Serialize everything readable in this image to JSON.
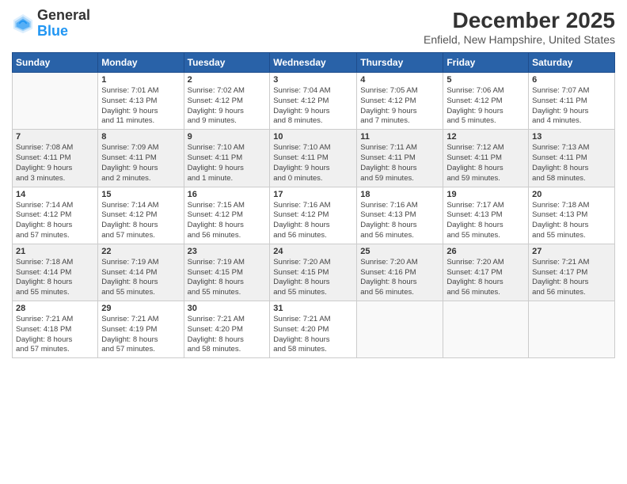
{
  "logo": {
    "line1": "General",
    "line2": "Blue"
  },
  "title": "December 2025",
  "location": "Enfield, New Hampshire, United States",
  "weekdays": [
    "Sunday",
    "Monday",
    "Tuesday",
    "Wednesday",
    "Thursday",
    "Friday",
    "Saturday"
  ],
  "weeks": [
    [
      {
        "day": "",
        "info": ""
      },
      {
        "day": "1",
        "info": "Sunrise: 7:01 AM\nSunset: 4:13 PM\nDaylight: 9 hours\nand 11 minutes."
      },
      {
        "day": "2",
        "info": "Sunrise: 7:02 AM\nSunset: 4:12 PM\nDaylight: 9 hours\nand 9 minutes."
      },
      {
        "day": "3",
        "info": "Sunrise: 7:04 AM\nSunset: 4:12 PM\nDaylight: 9 hours\nand 8 minutes."
      },
      {
        "day": "4",
        "info": "Sunrise: 7:05 AM\nSunset: 4:12 PM\nDaylight: 9 hours\nand 7 minutes."
      },
      {
        "day": "5",
        "info": "Sunrise: 7:06 AM\nSunset: 4:12 PM\nDaylight: 9 hours\nand 5 minutes."
      },
      {
        "day": "6",
        "info": "Sunrise: 7:07 AM\nSunset: 4:11 PM\nDaylight: 9 hours\nand 4 minutes."
      }
    ],
    [
      {
        "day": "7",
        "info": "Sunrise: 7:08 AM\nSunset: 4:11 PM\nDaylight: 9 hours\nand 3 minutes."
      },
      {
        "day": "8",
        "info": "Sunrise: 7:09 AM\nSunset: 4:11 PM\nDaylight: 9 hours\nand 2 minutes."
      },
      {
        "day": "9",
        "info": "Sunrise: 7:10 AM\nSunset: 4:11 PM\nDaylight: 9 hours\nand 1 minute."
      },
      {
        "day": "10",
        "info": "Sunrise: 7:10 AM\nSunset: 4:11 PM\nDaylight: 9 hours\nand 0 minutes."
      },
      {
        "day": "11",
        "info": "Sunrise: 7:11 AM\nSunset: 4:11 PM\nDaylight: 8 hours\nand 59 minutes."
      },
      {
        "day": "12",
        "info": "Sunrise: 7:12 AM\nSunset: 4:11 PM\nDaylight: 8 hours\nand 59 minutes."
      },
      {
        "day": "13",
        "info": "Sunrise: 7:13 AM\nSunset: 4:11 PM\nDaylight: 8 hours\nand 58 minutes."
      }
    ],
    [
      {
        "day": "14",
        "info": "Sunrise: 7:14 AM\nSunset: 4:12 PM\nDaylight: 8 hours\nand 57 minutes."
      },
      {
        "day": "15",
        "info": "Sunrise: 7:14 AM\nSunset: 4:12 PM\nDaylight: 8 hours\nand 57 minutes."
      },
      {
        "day": "16",
        "info": "Sunrise: 7:15 AM\nSunset: 4:12 PM\nDaylight: 8 hours\nand 56 minutes."
      },
      {
        "day": "17",
        "info": "Sunrise: 7:16 AM\nSunset: 4:12 PM\nDaylight: 8 hours\nand 56 minutes."
      },
      {
        "day": "18",
        "info": "Sunrise: 7:16 AM\nSunset: 4:13 PM\nDaylight: 8 hours\nand 56 minutes."
      },
      {
        "day": "19",
        "info": "Sunrise: 7:17 AM\nSunset: 4:13 PM\nDaylight: 8 hours\nand 55 minutes."
      },
      {
        "day": "20",
        "info": "Sunrise: 7:18 AM\nSunset: 4:13 PM\nDaylight: 8 hours\nand 55 minutes."
      }
    ],
    [
      {
        "day": "21",
        "info": "Sunrise: 7:18 AM\nSunset: 4:14 PM\nDaylight: 8 hours\nand 55 minutes."
      },
      {
        "day": "22",
        "info": "Sunrise: 7:19 AM\nSunset: 4:14 PM\nDaylight: 8 hours\nand 55 minutes."
      },
      {
        "day": "23",
        "info": "Sunrise: 7:19 AM\nSunset: 4:15 PM\nDaylight: 8 hours\nand 55 minutes."
      },
      {
        "day": "24",
        "info": "Sunrise: 7:20 AM\nSunset: 4:15 PM\nDaylight: 8 hours\nand 55 minutes."
      },
      {
        "day": "25",
        "info": "Sunrise: 7:20 AM\nSunset: 4:16 PM\nDaylight: 8 hours\nand 56 minutes."
      },
      {
        "day": "26",
        "info": "Sunrise: 7:20 AM\nSunset: 4:17 PM\nDaylight: 8 hours\nand 56 minutes."
      },
      {
        "day": "27",
        "info": "Sunrise: 7:21 AM\nSunset: 4:17 PM\nDaylight: 8 hours\nand 56 minutes."
      }
    ],
    [
      {
        "day": "28",
        "info": "Sunrise: 7:21 AM\nSunset: 4:18 PM\nDaylight: 8 hours\nand 57 minutes."
      },
      {
        "day": "29",
        "info": "Sunrise: 7:21 AM\nSunset: 4:19 PM\nDaylight: 8 hours\nand 57 minutes."
      },
      {
        "day": "30",
        "info": "Sunrise: 7:21 AM\nSunset: 4:20 PM\nDaylight: 8 hours\nand 58 minutes."
      },
      {
        "day": "31",
        "info": "Sunrise: 7:21 AM\nSunset: 4:20 PM\nDaylight: 8 hours\nand 58 minutes."
      },
      {
        "day": "",
        "info": ""
      },
      {
        "day": "",
        "info": ""
      },
      {
        "day": "",
        "info": ""
      }
    ]
  ]
}
